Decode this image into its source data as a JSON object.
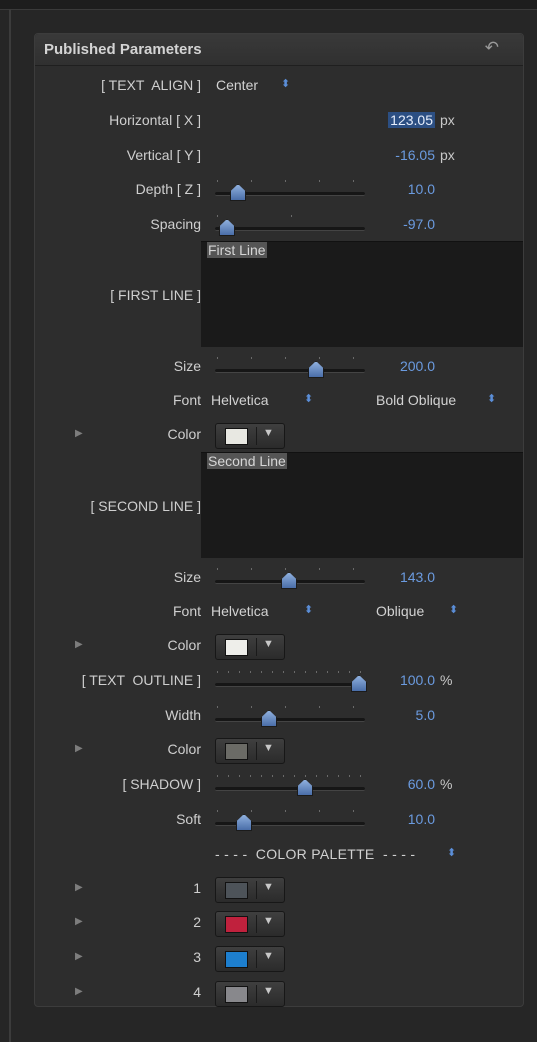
{
  "panel": {
    "title": "Published Parameters"
  },
  "text_align": {
    "label": "[ TEXT  ALIGN ]",
    "value": "Center"
  },
  "horizontal": {
    "label": "Horizontal [ X ]",
    "value": "123.05",
    "unit": "px"
  },
  "vertical": {
    "label": "Vertical [ Y ]",
    "value": "-16.05",
    "unit": "px"
  },
  "depth": {
    "label": "Depth [ Z ]",
    "value": "10.0"
  },
  "spacing": {
    "label": "Spacing",
    "value": "-97.0"
  },
  "first_line": {
    "label": "[ FIRST LINE ]",
    "text": "First Line"
  },
  "size1": {
    "label": "Size",
    "value": "200.0"
  },
  "font1": {
    "label": "Font",
    "family": "Helvetica",
    "style": "Bold Oblique"
  },
  "color1": {
    "label": "Color",
    "hex": "#e8e8e2"
  },
  "second_line": {
    "label": "[ SECOND LINE ]",
    "text": "Second Line"
  },
  "size2": {
    "label": "Size",
    "value": "143.0"
  },
  "font2": {
    "label": "Font",
    "family": "Helvetica",
    "style": "Oblique"
  },
  "color2": {
    "label": "Color",
    "hex": "#eeeeea"
  },
  "text_outline": {
    "label": "[ TEXT  OUTLINE ]",
    "value": "100.0",
    "unit": "%"
  },
  "width": {
    "label": "Width",
    "value": "5.0"
  },
  "color3": {
    "label": "Color",
    "hex": "#6b6b66"
  },
  "shadow": {
    "label": "[ SHADOW ]",
    "value": "60.0",
    "unit": "%"
  },
  "soft": {
    "label": "Soft",
    "value": "10.0"
  },
  "palette": {
    "title": "- - - -  COLOR PALETTE  - - - -",
    "items": [
      {
        "label": "1",
        "hex": "#4d5359"
      },
      {
        "label": "2",
        "hex": "#c0213d"
      },
      {
        "label": "3",
        "hex": "#1d7fcf"
      },
      {
        "label": "4",
        "hex": "#88888c"
      }
    ]
  },
  "icons": {
    "reset": "reset-arrow-icon",
    "disclosure": "disclosure-triangle-icon",
    "dropdown": "dropdown-arrow-icon",
    "stepper": "up-down-arrows-icon"
  }
}
